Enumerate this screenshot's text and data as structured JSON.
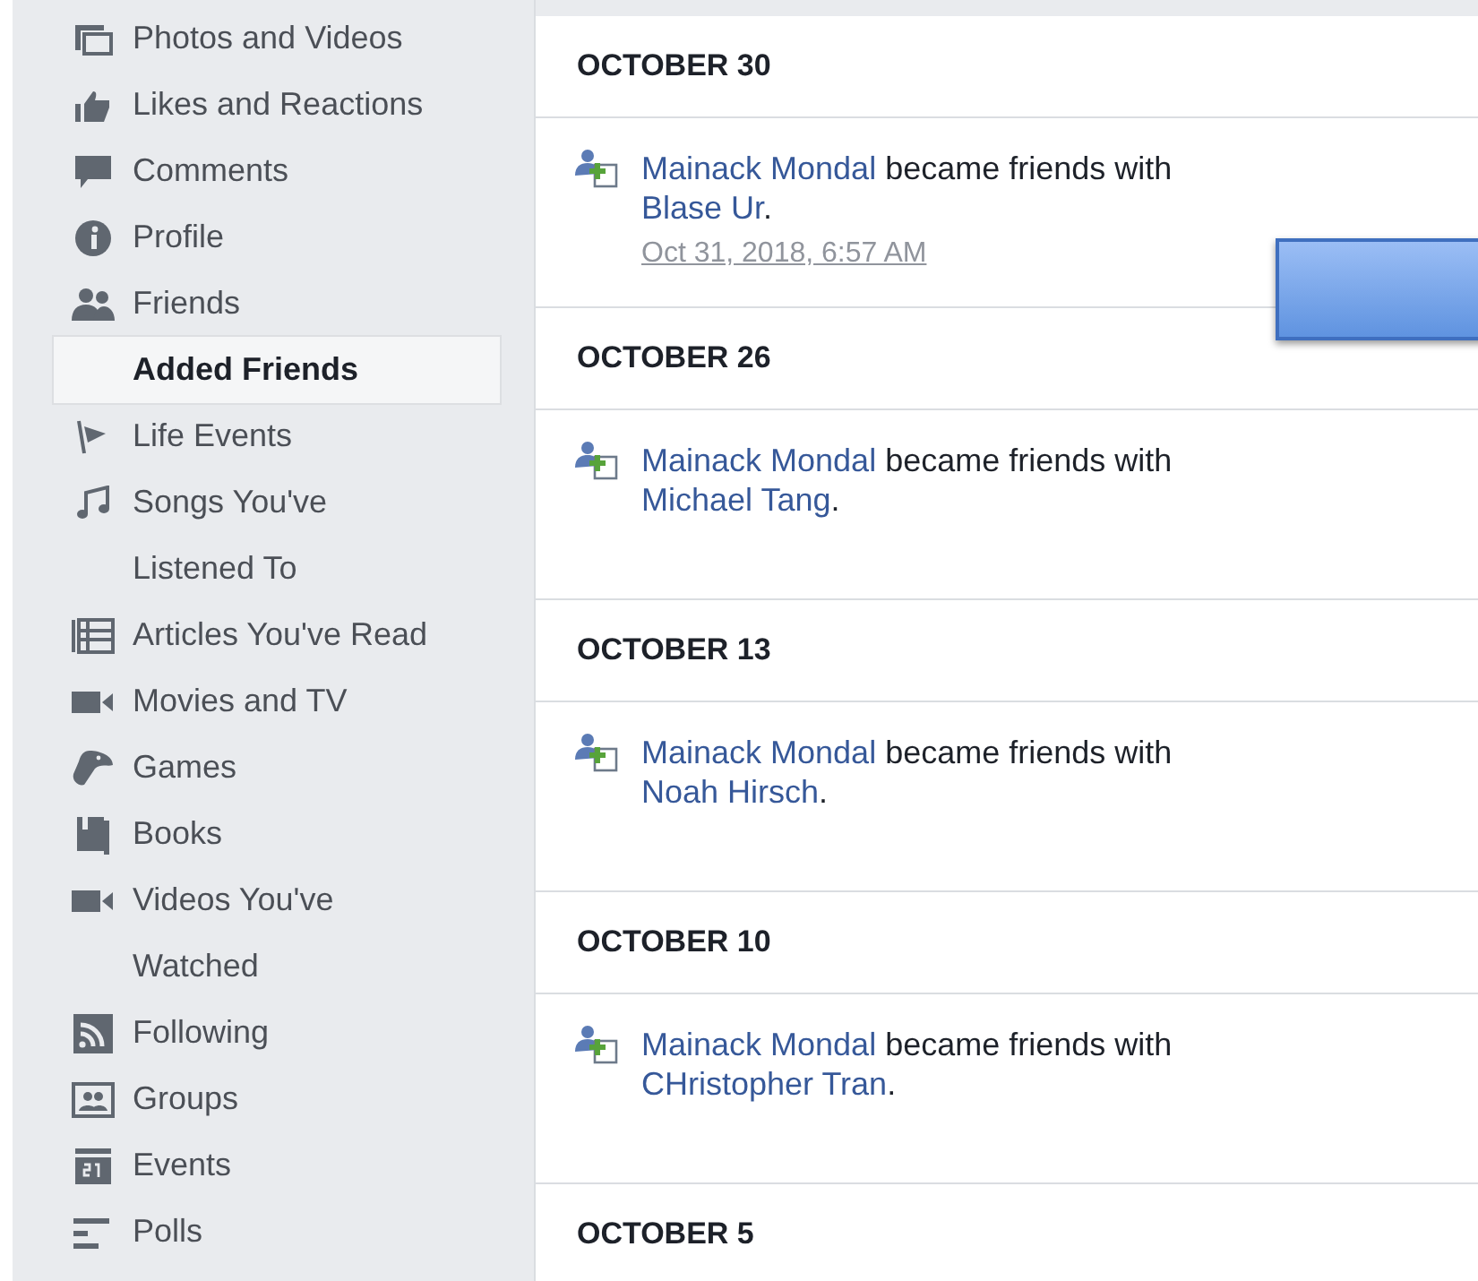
{
  "sidebar": {
    "items": [
      {
        "label": "Photos and Videos",
        "kind": "category",
        "selected": false
      },
      {
        "label": "Likes and Reactions",
        "kind": "category",
        "selected": false
      },
      {
        "label": "Comments",
        "kind": "category",
        "selected": false
      },
      {
        "label": "Profile",
        "kind": "category",
        "selected": false
      },
      {
        "label": "Friends",
        "kind": "category",
        "selected": false
      },
      {
        "label": "Added Friends",
        "kind": "subcategory",
        "selected": true
      },
      {
        "label": "Life Events",
        "kind": "category",
        "selected": false
      },
      {
        "label": "Songs You've Listened To",
        "kind": "category",
        "selected": false
      },
      {
        "label": "Articles You've Read",
        "kind": "category",
        "selected": false
      },
      {
        "label": "Movies and TV",
        "kind": "category",
        "selected": false
      },
      {
        "label": "Games",
        "kind": "category",
        "selected": false
      },
      {
        "label": "Books",
        "kind": "category",
        "selected": false
      },
      {
        "label": "Videos You've Watched",
        "kind": "category",
        "selected": false
      },
      {
        "label": "Following",
        "kind": "category",
        "selected": false
      },
      {
        "label": "Groups",
        "kind": "category",
        "selected": false
      },
      {
        "label": "Events",
        "kind": "category",
        "selected": false
      },
      {
        "label": "Polls",
        "kind": "category",
        "selected": false
      }
    ]
  },
  "activity": {
    "sections": [
      {
        "date": "OCTOBER 30",
        "entries": [
          {
            "actor": "Mainack Mondal",
            "action": " became friends with ",
            "friend": "Blase Ur",
            "end": ".",
            "timestamp": "Oct 31, 2018, 6:57 AM"
          }
        ]
      },
      {
        "date": "OCTOBER 26",
        "entries": [
          {
            "actor": "Mainack Mondal",
            "action": " became friends with ",
            "friend": "Michael Tang",
            "end": "."
          }
        ]
      },
      {
        "date": "OCTOBER 13",
        "entries": [
          {
            "actor": "Mainack Mondal",
            "action": " became friends with ",
            "friend": "Noah Hirsch",
            "end": "."
          }
        ]
      },
      {
        "date": "OCTOBER 10",
        "entries": [
          {
            "actor": "Mainack Mondal",
            "action": " became friends with ",
            "friend": "CHristopher Tran",
            "end": "."
          }
        ]
      },
      {
        "date": "OCTOBER 5"
      }
    ]
  }
}
